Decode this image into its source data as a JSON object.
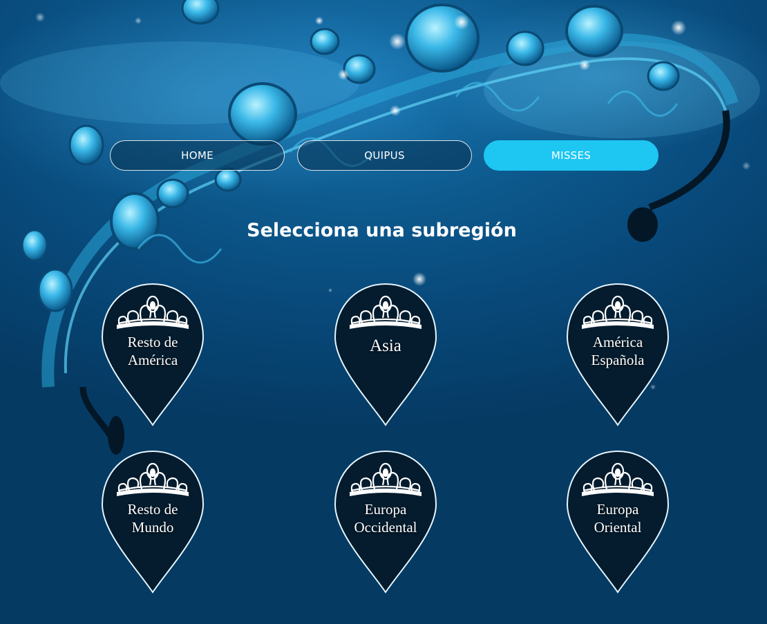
{
  "nav": {
    "items": [
      {
        "label": "HOME",
        "active": false
      },
      {
        "label": "QUIPUS",
        "active": false
      },
      {
        "label": "MISSES",
        "active": true
      }
    ]
  },
  "heading": "Selecciona una subregión",
  "regions": [
    {
      "line1": "Resto de",
      "line2": "América"
    },
    {
      "line1": "Asia",
      "line2": ""
    },
    {
      "line1": "América",
      "line2": "Española"
    },
    {
      "line1": "Resto de",
      "line2": "Mundo"
    },
    {
      "line1": "Europa",
      "line2": "Occidental"
    },
    {
      "line1": "Europa",
      "line2": "Oriental"
    }
  ],
  "colors": {
    "accent": "#1ec6f2",
    "pin_fill": "#041c2e",
    "background": "#08497a"
  },
  "icons": {
    "pin_emblem": "tiara-icon",
    "background_decoration": "tiara-photo"
  }
}
